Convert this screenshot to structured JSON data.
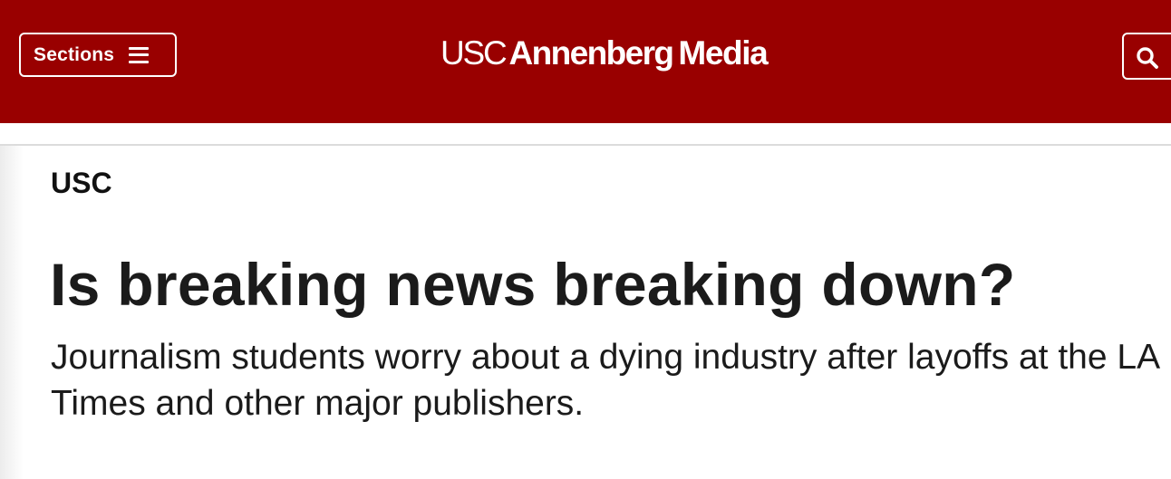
{
  "header": {
    "sections_label": "Sections",
    "menu_icon": "hamburger-menu-icon",
    "logo_light": "USC",
    "logo_bold_1": "Annenberg",
    "logo_bold_2": "Media",
    "search_icon": "search-icon",
    "background_color": "#990000",
    "foreground_color": "#ffffff"
  },
  "article": {
    "section": "USC",
    "headline": "Is breaking news breaking down?",
    "dek": "Journalism students worry about a dying industry after layoffs at the LA Times and other major publishers.",
    "text_color": "#1b1b1b"
  }
}
